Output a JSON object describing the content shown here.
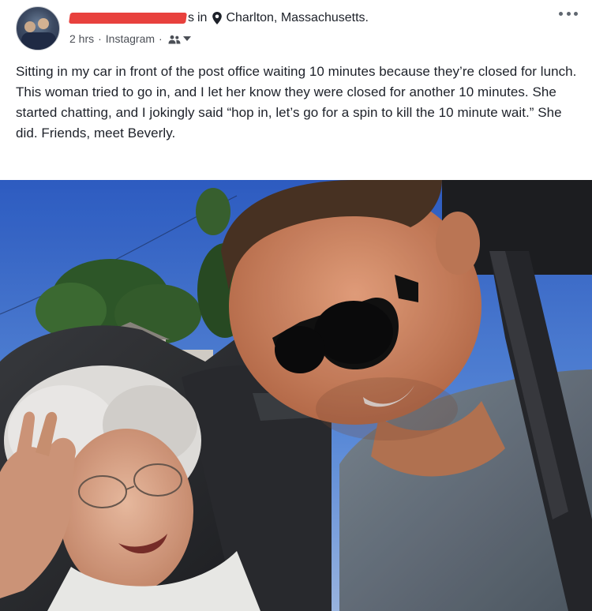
{
  "post": {
    "author_suffix": "s",
    "in_word": "in",
    "location": "Charlton, Massachusetts.",
    "time": "2 hrs",
    "separator": "·",
    "source": "Instagram",
    "audience_icon": "friends-icon",
    "more_icon": "more-options-icon",
    "location_icon": "location-pin-icon",
    "body": "Sitting in my car in front of the post office waiting 10 minutes because they’re closed for lunch. This woman tried to go in, and I let her know they were closed for another 10 minutes. She started chatting, and I jokingly said “hop in, let’s go for a spin to kill the 10 minute wait.” She did. Friends, meet Beverly."
  },
  "colors": {
    "redaction": "#e8413d",
    "text": "#1d2129",
    "meta": "#4b4f56"
  }
}
